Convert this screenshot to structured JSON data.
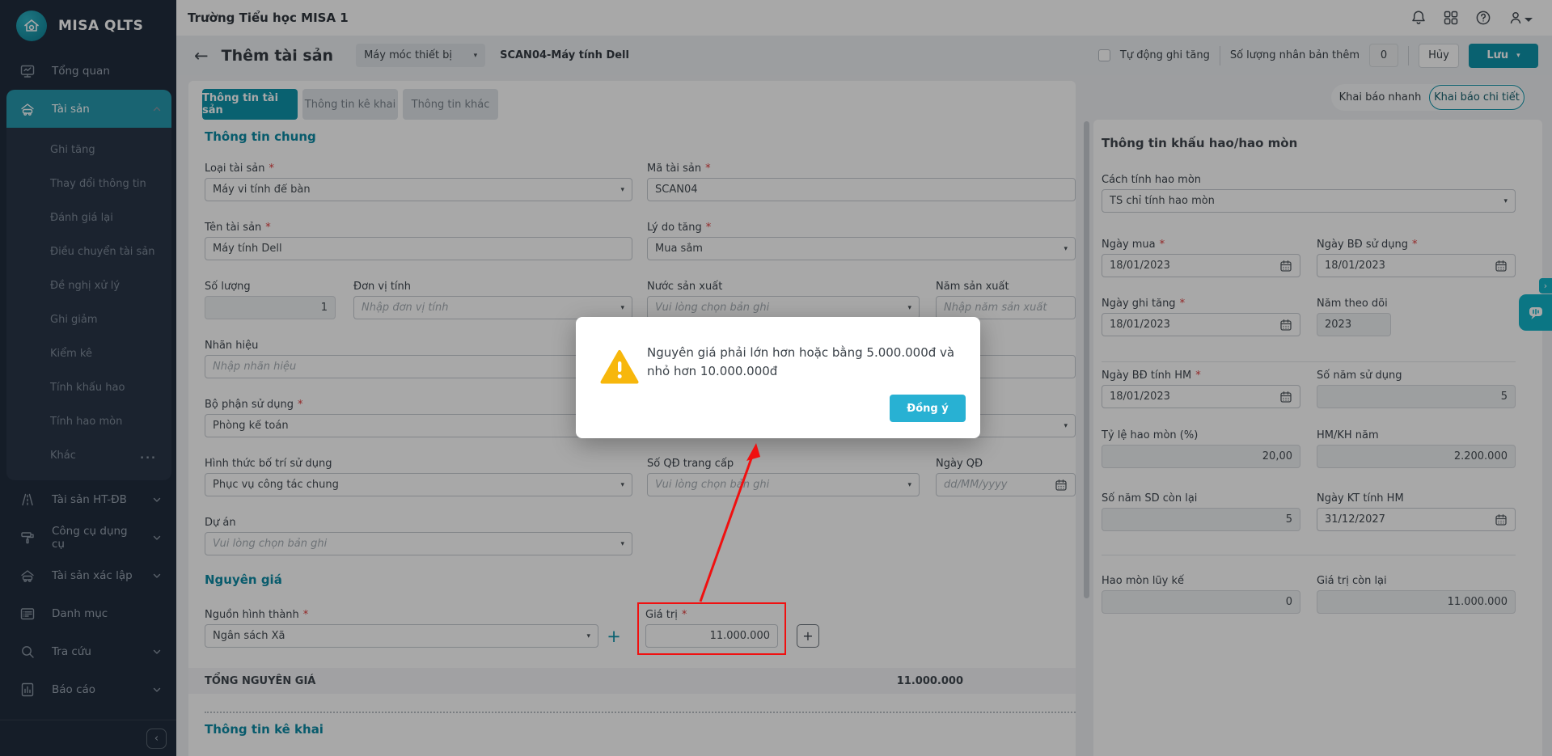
{
  "icons": {
    "caret_down": "▾",
    "back_arrow": "←",
    "ellipsis": "...",
    "collapse": "‹",
    "expand": "›",
    "plus": "+"
  },
  "sidebar": {
    "brand": "MISA QLTS",
    "items": [
      {
        "label": "Tổng quan",
        "icon": "overview",
        "type": "main"
      },
      {
        "label": "Tài sản",
        "icon": "asset",
        "type": "main",
        "active": true,
        "chevron": "up"
      },
      {
        "label": "Ghi tăng",
        "type": "sub"
      },
      {
        "label": "Thay đổi thông tin",
        "type": "sub"
      },
      {
        "label": "Đánh giá lại",
        "type": "sub"
      },
      {
        "label": "Điều chuyển tài sản",
        "type": "sub"
      },
      {
        "label": "Đề nghị xử lý",
        "type": "sub"
      },
      {
        "label": "Ghi giảm",
        "type": "sub"
      },
      {
        "label": "Kiểm kê",
        "type": "sub"
      },
      {
        "label": "Tính khấu hao",
        "type": "sub"
      },
      {
        "label": "Tính hao mòn",
        "type": "sub"
      },
      {
        "label": "Khác",
        "type": "sub",
        "trailing": "..."
      },
      {
        "label": "Tài sản HT-ĐB",
        "icon": "road",
        "type": "main",
        "chevron": "down"
      },
      {
        "label": "Công cụ dụng cụ",
        "icon": "roller",
        "type": "main",
        "chevron": "down"
      },
      {
        "label": "Tài sản xác lập",
        "icon": "asset",
        "type": "main",
        "chevron": "down"
      },
      {
        "label": "Danh mục",
        "icon": "list",
        "type": "main"
      },
      {
        "label": "Tra cứu",
        "icon": "search",
        "type": "main",
        "chevron": "down"
      },
      {
        "label": "Báo cáo",
        "icon": "report",
        "type": "main",
        "chevron": "down"
      }
    ]
  },
  "topbar": {
    "title": "Trường Tiểu học MISA 1"
  },
  "header": {
    "title": "Thêm tài sản",
    "type_dropdown": "Máy móc thiết bị",
    "asset_code": "SCAN04-Máy tính Dell",
    "auto_record_label": "Tự động ghi tăng",
    "clone_label": "Số lượng nhân bản thêm",
    "clone_value": "0",
    "cancel_label": "Hủy",
    "save_label": "Lưu"
  },
  "view_toggle": {
    "quick": "Khai báo nhanh",
    "detail": "Khai báo chi tiết"
  },
  "tabs": [
    {
      "label": "Thông tin tài sản",
      "active": true
    },
    {
      "label": "Thông tin kê khai",
      "active": false
    },
    {
      "label": "Thông tin khác",
      "active": false
    }
  ],
  "form": {
    "section_general": "Thông tin chung",
    "section_cost": "Nguyên giá",
    "section_declare": "Thông tin kê khai",
    "total_label": "TỔNG NGUYÊN GIÁ",
    "total_value": "11.000.000",
    "fields": {
      "loai_tai_san": {
        "label": "Loại tài sản",
        "value": "Máy vi tính để bàn"
      },
      "ma_tai_san": {
        "label": "Mã tài sản",
        "value": "SCAN04"
      },
      "ten_tai_san": {
        "label": "Tên tài sản",
        "value": "Máy tính Dell"
      },
      "ly_do_tang": {
        "label": "Lý do tăng",
        "value": "Mua sắm"
      },
      "so_luong": {
        "label": "Số lượng",
        "value": "1"
      },
      "don_vi_tinh": {
        "label": "Đơn vị tính",
        "placeholder": "Nhập đơn vị tính"
      },
      "nuoc_san_xuat": {
        "label": "Nước sản xuất",
        "placeholder": "Vui lòng chọn bản ghi"
      },
      "nam_san_xuat": {
        "label": "Năm sản xuất",
        "placeholder": "Nhập năm sản xuất"
      },
      "nhan_hieu": {
        "label": "Nhãn hiệu",
        "placeholder": "Nhập nhãn hiệu"
      },
      "bo_phan_su_dung": {
        "label": "Bộ phận sử dụng",
        "value": "Phòng kế toán"
      },
      "hinh_thuc": {
        "label": "Hình thức bố trí sử dụng",
        "value": "Phục vụ công tác chung"
      },
      "so_qd_trang_cap": {
        "label": "Số QĐ trang cấp",
        "placeholder": "Vui lòng chọn bản ghi"
      },
      "ngay_qd": {
        "label": "Ngày QĐ",
        "placeholder": "dd/MM/yyyy"
      },
      "du_an": {
        "label": "Dự án",
        "placeholder": "Vui lòng chọn bản ghi"
      },
      "nguon_hinh_thanh": {
        "label": "Nguồn hình thành",
        "value": "Ngân sách Xã"
      },
      "gia_tri": {
        "label": "Giá trị",
        "value": "11.000.000"
      }
    }
  },
  "dep": {
    "title": "Thông tin khấu hao/hao mòn",
    "fields": {
      "cach_tinh": {
        "label": "Cách tính hao mòn",
        "value": "TS chỉ tính hao mòn"
      },
      "ngay_mua": {
        "label": "Ngày mua",
        "value": "18/01/2023"
      },
      "ngay_bd_su_dung": {
        "label": "Ngày BĐ sử dụng",
        "value": "18/01/2023"
      },
      "ngay_ghi_tang": {
        "label": "Ngày ghi tăng",
        "value": "18/01/2023"
      },
      "nam_theo_doi": {
        "label": "Năm theo dõi",
        "value": "2023"
      },
      "ngay_bd_tinh_hm": {
        "label": "Ngày BĐ tính HM",
        "value": "18/01/2023"
      },
      "so_nam_su_dung": {
        "label": "Số năm sử dụng",
        "value": "5"
      },
      "ty_le_hao_mon": {
        "label": "Tỷ lệ hao mòn (%)",
        "value": "20,00"
      },
      "hm_kh_nam": {
        "label": "HM/KH năm",
        "value": "2.200.000"
      },
      "so_nam_sd_con_lai": {
        "label": "Số năm SD còn lại",
        "value": "5"
      },
      "ngay_kt_tinh_hm": {
        "label": "Ngày KT tính HM",
        "value": "31/12/2027"
      },
      "hao_mon_luy_ke": {
        "label": "Hao mòn lũy kế",
        "value": "0"
      },
      "gia_tri_con_lai": {
        "label": "Giá trị còn lại",
        "value": "11.000.000"
      }
    }
  },
  "modal": {
    "message": "Nguyên giá phải lớn hơn hoặc bằng 5.000.000đ và nhỏ hơn 10.000.000đ",
    "ok_label": "Đồng ý"
  },
  "colors": {
    "accent_teal": "#0e93ab",
    "modal_button": "#28b1d3",
    "warning_yellow": "#f7b70c",
    "annotation_red": "#f01010",
    "sidebar_bg": "#212d3d"
  }
}
